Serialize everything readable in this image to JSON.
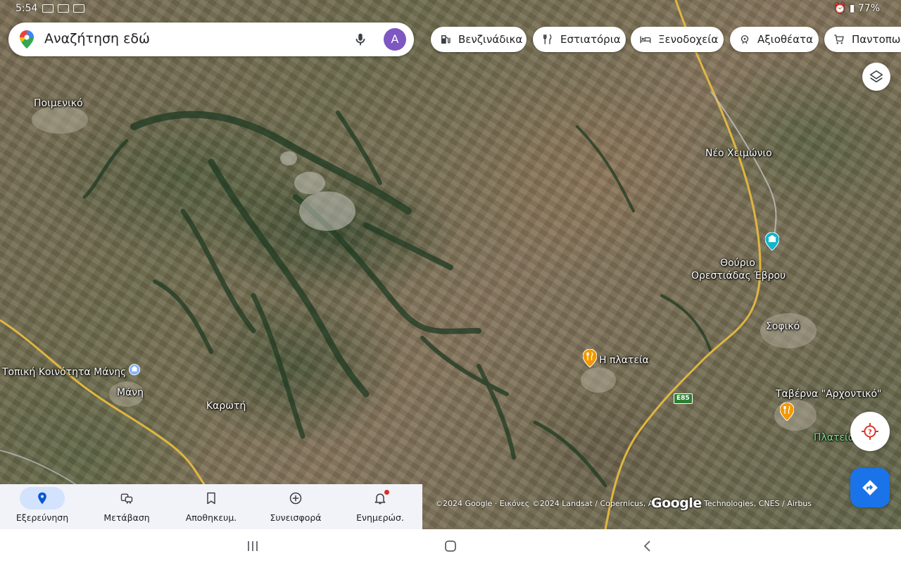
{
  "status_bar": {
    "time": "5:54",
    "battery": "77%"
  },
  "search": {
    "placeholder": "Αναζήτηση εδώ",
    "avatar_initial": "A"
  },
  "chips": [
    {
      "label": "Βενζινάδικα",
      "icon": "gas-station-icon"
    },
    {
      "label": "Εστιατόρια",
      "icon": "restaurant-icon"
    },
    {
      "label": "Ξενοδοχεία",
      "icon": "hotel-icon"
    },
    {
      "label": "Αξιοθέατα",
      "icon": "attractions-icon"
    },
    {
      "label": "Παντοπωλ",
      "icon": "shopping-cart-icon"
    }
  ],
  "map": {
    "labels": {
      "poimeniko": "Ποιμενικό",
      "neo_cheimonio": "Νέο Χειμώνιο",
      "thourio_1": "Θούριο",
      "thourio_2": "Ορεστιάδας Έβρου",
      "sofiko": "Σοφικό",
      "platia": "Η πλατεία",
      "taverna": "Ταβέρνα \"Αρχοντικό\"",
      "platia_green": "Πλατεία",
      "topiki": "Τοπική Κοινότητα Μάνης",
      "mani": "Μάνη",
      "karoti": "Καρωτή"
    },
    "road_shield": "E85",
    "attribution": "©2024 Google · Εικόνες ©2024 Landsat / Copernicus, Airbus, Maxar Technologies, CNES / Airbus",
    "google_logo": "Google"
  },
  "bottom_nav": [
    {
      "label": "Εξερεύνηση",
      "icon": "explore-pin-icon",
      "active": true
    },
    {
      "label": "Μετάβαση",
      "icon": "commute-icon",
      "active": false
    },
    {
      "label": "Αποθηκευμ.",
      "icon": "bookmark-icon",
      "active": false
    },
    {
      "label": "Συνεισφορά",
      "icon": "add-circle-icon",
      "active": false
    },
    {
      "label": "Ενημερώσ.",
      "icon": "bell-icon",
      "active": false
    }
  ],
  "colors": {
    "accent_blue": "#1a73e8",
    "active_pill": "#d3e3fd",
    "avatar_purple": "#7e57c2",
    "restaurant_pin": "#f29900",
    "civic_pin": "#12b5cb"
  }
}
